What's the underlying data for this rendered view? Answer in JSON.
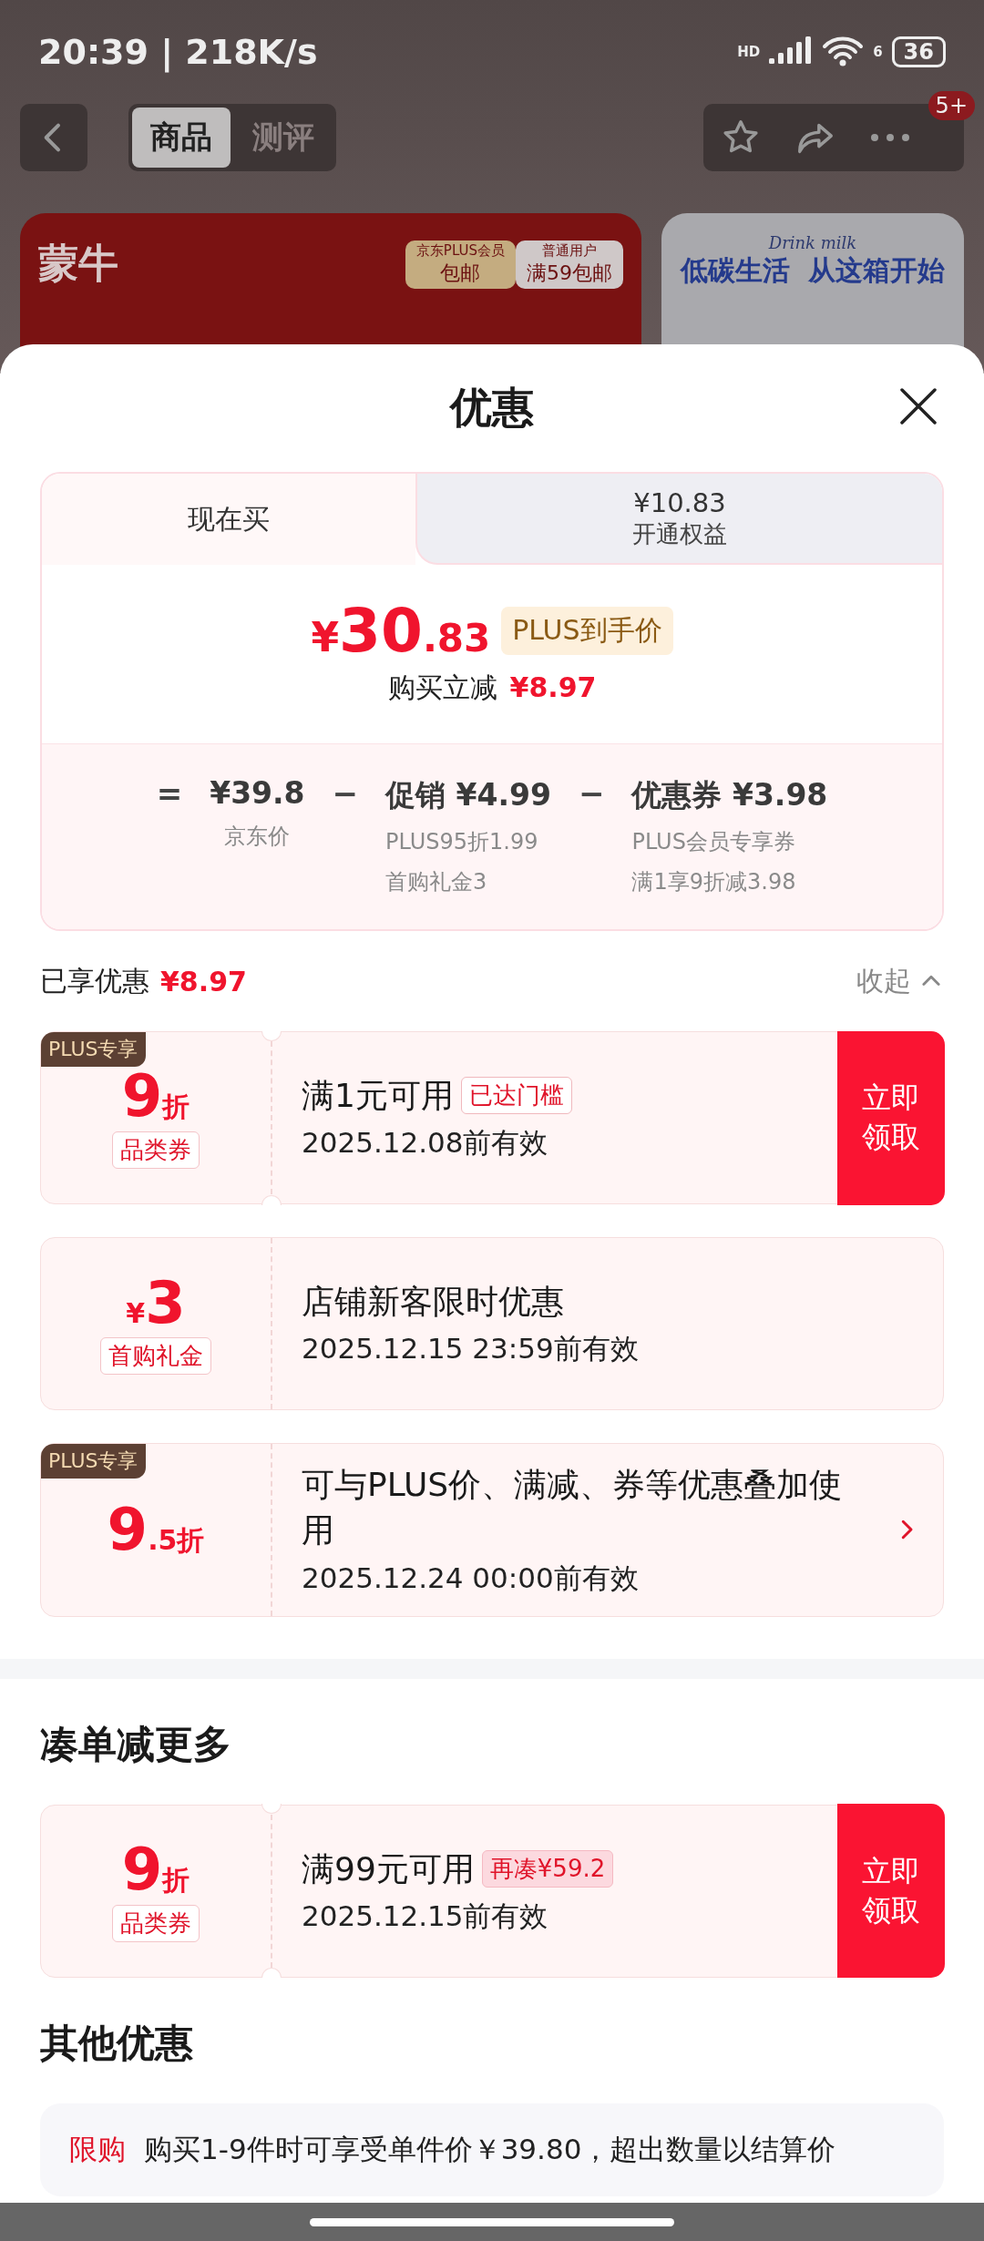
{
  "status_bar": {
    "time": "20:39 | 218K/s",
    "network_label": "HD",
    "wifi_label": "6",
    "battery": "36"
  },
  "nav": {
    "tabs": [
      {
        "label": "商品",
        "selected": true
      },
      {
        "label": "测评",
        "selected": false
      }
    ],
    "badge": "5+"
  },
  "banner": {
    "brand": "蒙牛",
    "chips": [
      {
        "title": "京东PLUS会员",
        "text": "包邮",
        "kind": "gold"
      },
      {
        "title": "普通用户",
        "text": "满59包邮",
        "kind": "plain"
      }
    ],
    "side_script": "Drink milk",
    "side_text": "低碳生活  从这箱开始"
  },
  "sheet": {
    "title": "优惠",
    "price_card": {
      "tabs": [
        {
          "label": "现在买",
          "selected": true
        },
        {
          "label": "¥10.83",
          "sub": "开通权益",
          "selected": false
        }
      ],
      "price": {
        "symbol": "¥",
        "integer": "30",
        "decimal": ".83"
      },
      "price_badge": "PLUS到手价",
      "saving_label": "购买立减",
      "saving_value": "¥8.97",
      "breakdown": [
        {
          "op": "=",
          "label": "¥39.8",
          "notes": [
            "京东价"
          ]
        },
        {
          "op": "−",
          "label": "促销 ¥4.99",
          "notes": [
            "PLUS95折1.99",
            "首购礼金3"
          ]
        },
        {
          "op": "−",
          "label": "优惠券 ¥3.98",
          "notes": [
            "PLUS会员专享券",
            "满1享9折减3.98"
          ]
        }
      ]
    },
    "summary": {
      "label": "已享优惠",
      "value": "¥8.97",
      "toggle": "收起",
      "expanded": true
    },
    "coupons": [
      {
        "badge": "PLUS专享",
        "value": "9",
        "unit": "折",
        "tag": "品类券",
        "title": "满1元可用",
        "chip": {
          "text": "已达门槛",
          "kind": "outline"
        },
        "date": "2025.12.08前有效",
        "notched": true,
        "action": {
          "kind": "button",
          "label": "立即领取"
        }
      },
      {
        "prefix": "¥",
        "value": "3",
        "tag": "首购礼金",
        "title": "店铺新客限时优惠",
        "date": "2025.12.15 23:59前有效",
        "notched": false
      },
      {
        "badge": "PLUS专享",
        "value": "9",
        "unit": ".5折",
        "title": "可与PLUS价、满减、券等优惠叠加使用",
        "date": "2025.12.24 00:00前有效",
        "notched": false,
        "action": {
          "kind": "chevron"
        }
      }
    ],
    "more_title": "凑单减更多",
    "more_coupons": [
      {
        "value": "9",
        "unit": "折",
        "tag": "品类券",
        "title": "满99元可用",
        "chip": {
          "text": "再凑¥59.2",
          "kind": "filled"
        },
        "date": "2025.12.15前有效",
        "notched": true,
        "action": {
          "kind": "button",
          "label": "立即领取"
        }
      }
    ],
    "other_title": "其他优惠",
    "other": [
      {
        "tag": "限购",
        "text": "购买1-9件时可享受单件价￥39.80，超出数量以结算价"
      }
    ]
  }
}
